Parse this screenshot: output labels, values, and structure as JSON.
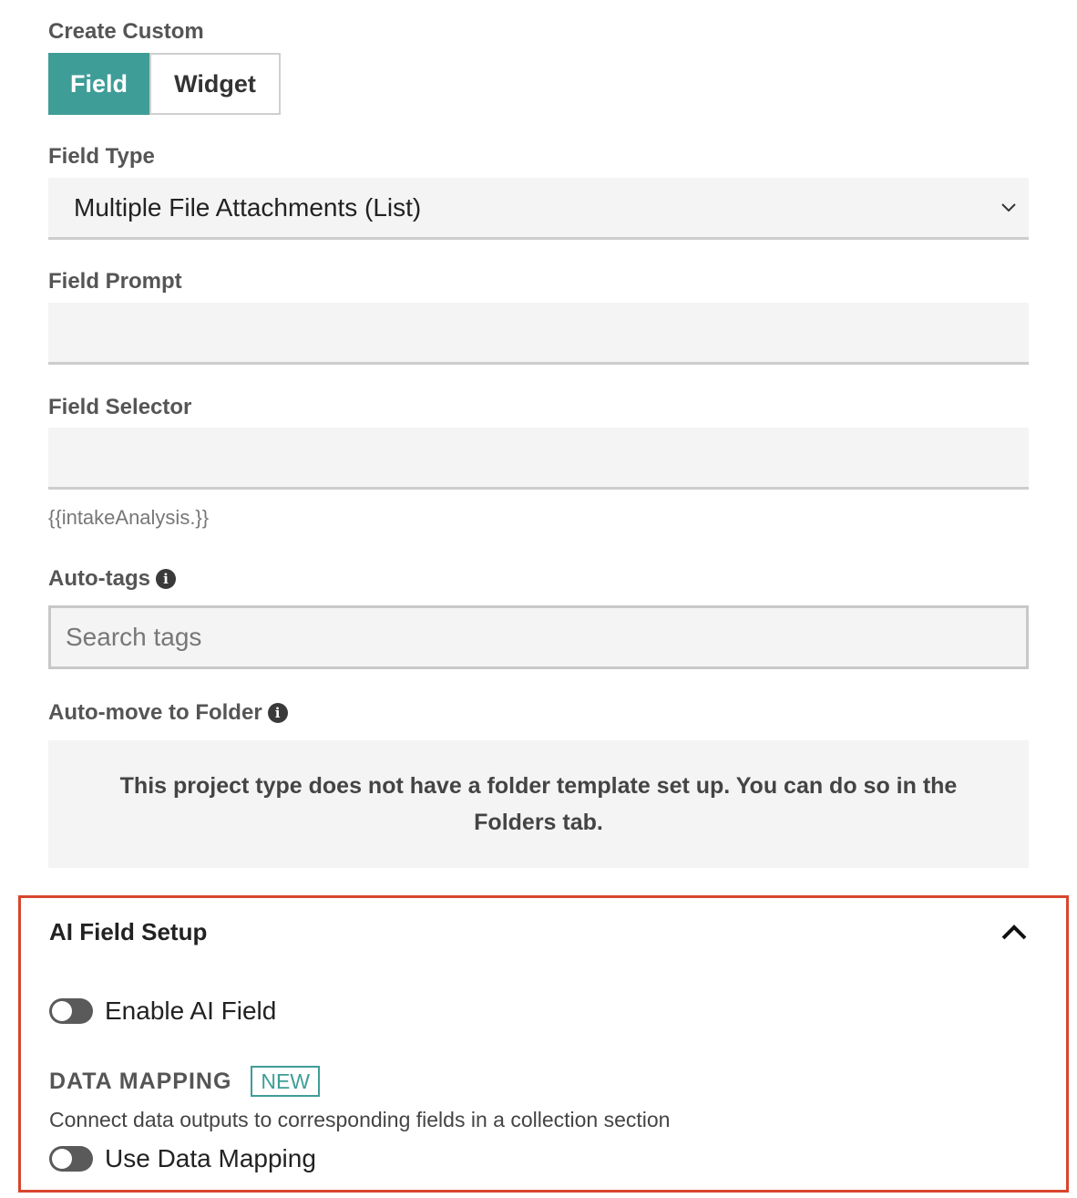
{
  "create_custom": {
    "label": "Create Custom",
    "tabs": [
      {
        "label": "Field",
        "active": true
      },
      {
        "label": "Widget",
        "active": false
      }
    ]
  },
  "field_type": {
    "label": "Field Type",
    "value": "Multiple File Attachments (List)"
  },
  "field_prompt": {
    "label": "Field Prompt",
    "value": ""
  },
  "field_selector": {
    "label": "Field Selector",
    "value": "",
    "helper": "{{intakeAnalysis.}}"
  },
  "auto_tags": {
    "label": "Auto-tags",
    "placeholder": "Search tags"
  },
  "auto_move": {
    "label": "Auto-move to Folder",
    "notice": "This project type does not have a folder template set up. You can do so in the Folders tab."
  },
  "ai_setup": {
    "title": "AI Field Setup",
    "enable_label": "Enable AI Field",
    "enable_on": false,
    "data_mapping_title": "DATA MAPPING",
    "data_mapping_badge": "NEW",
    "data_mapping_desc": "Connect data outputs to corresponding fields in a collection section",
    "use_mapping_label": "Use Data Mapping",
    "use_mapping_on": false
  },
  "colors": {
    "accent": "#3f9d98",
    "highlight_border": "#d8452e",
    "field_bg": "#f4f4f4"
  },
  "icons": {
    "info": "info-icon",
    "dropdown": "chevron-down-icon",
    "collapse": "chevron-up-icon"
  }
}
